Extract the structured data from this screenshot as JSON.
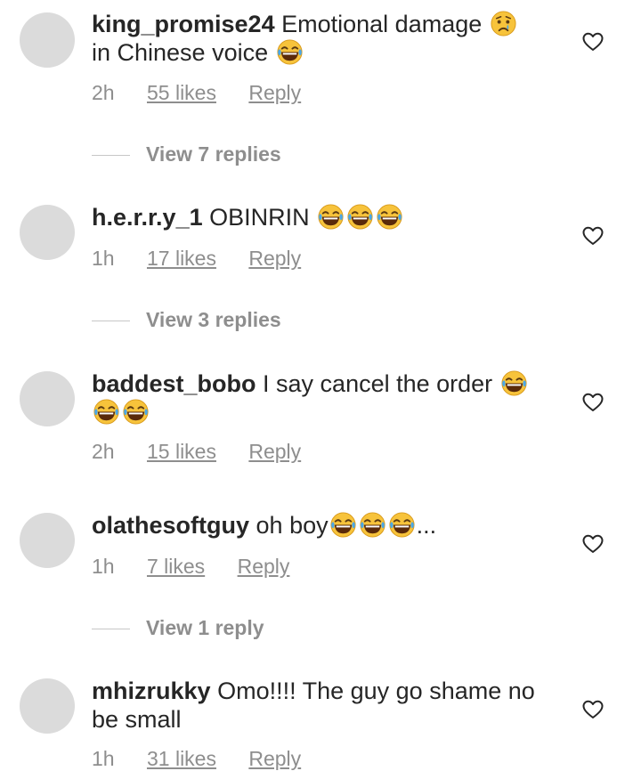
{
  "comments": [
    {
      "username": "king_promise24",
      "text": "Emotional damage",
      "text2": "in Chinese voice",
      "time": "2h",
      "likes": "55 likes",
      "reply": "Reply",
      "view_replies": "View 7 replies",
      "emoji_icons": [
        "crying-face-emoji",
        "laughing-tears-emoji"
      ]
    },
    {
      "username": "h.e.r.r.y_1",
      "text": "OBINRIN",
      "time": "1h",
      "likes": "17 likes",
      "reply": "Reply",
      "view_replies": "View 3 replies",
      "emoji_icons": [
        "laughing-tears-emoji",
        "laughing-tears-emoji",
        "laughing-tears-emoji"
      ]
    },
    {
      "username": "baddest_bobo",
      "text": "I say cancel the order",
      "time": "2h",
      "likes": "15 likes",
      "reply": "Reply",
      "emoji_icons": [
        "laughing-tears-emoji",
        "laughing-tears-emoji",
        "laughing-tears-emoji"
      ]
    },
    {
      "username": "olathesoftguy",
      "text": "oh boy",
      "suffix": "...",
      "time": "1h",
      "likes": "7 likes",
      "reply": "Reply",
      "view_replies": "View 1 reply",
      "emoji_icons": [
        "laughing-tears-emoji",
        "laughing-tears-emoji",
        "laughing-tears-emoji"
      ]
    },
    {
      "username": "mhizrukky",
      "text": "Omo!!!! The guy go shame no",
      "text2": "be small",
      "time": "1h",
      "likes": "31 likes",
      "reply": "Reply"
    }
  ],
  "colors": {
    "text": "#262626",
    "secondary": "#8e8e8e",
    "avatar": "#dbdbdb",
    "emoji_yellow": "#f7c33b"
  },
  "icons": [
    "heart-icon",
    "laughing-tears-emoji",
    "crying-face-emoji"
  ]
}
